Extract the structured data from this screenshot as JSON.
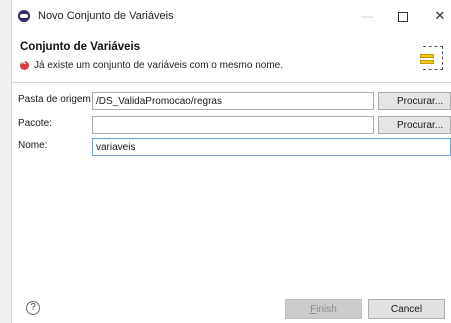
{
  "window": {
    "title": "Novo Conjunto de Variáveis",
    "minimize_glyph": "—",
    "close_glyph": "✕"
  },
  "header": {
    "title": "Conjunto de Variáveis",
    "message": "Já existe um conjunto de variáveis com o mesmo nome."
  },
  "form": {
    "source_folder": {
      "label": "Pasta de origem:",
      "value": "/DS_ValidaPromocao/regras",
      "button": "Procurar..."
    },
    "package": {
      "label": "Pacote:",
      "value": "",
      "button": "Procurar..."
    },
    "name": {
      "label": "Nome:",
      "value": "variaveis"
    }
  },
  "footer": {
    "help_glyph": "?",
    "finish_first": "F",
    "finish_rest": "inish",
    "cancel": "Cancel"
  },
  "colors": {
    "error": "#d93a3a",
    "focus_border": "#6aa0dc",
    "wizard_icon": "#f3c712"
  }
}
